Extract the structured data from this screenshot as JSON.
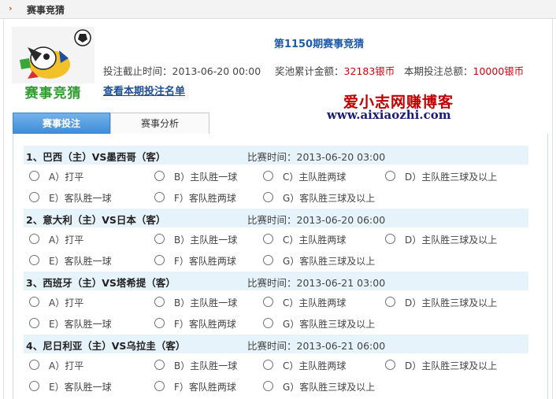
{
  "header": {
    "title": "赛事竞猜"
  },
  "logo": {
    "label": "赛事竞猜"
  },
  "issue": {
    "title": "第1150期赛事竞猜",
    "deadline_label": "投注截止时间：",
    "deadline": "2013-06-20 00:00",
    "pool_label": "奖池累计金额：",
    "pool": "32183银币",
    "total_label": "本期投注总额：",
    "total": "10000银币",
    "list_link": "查看本期投注名单"
  },
  "watermark": {
    "line1": "爱小志网赚博客",
    "line2": "www.aixiaozhi.com"
  },
  "tabs": [
    {
      "label": "赛事投注"
    },
    {
      "label": "赛事分析"
    }
  ],
  "options": [
    "A）打平",
    "B）主队胜一球",
    "C）主队胜两球",
    "D）主队胜三球及以上",
    "E）客队胜一球",
    "F）客队胜两球",
    "G）客队胜三球及以上"
  ],
  "matches": [
    {
      "name": "1、巴西（主）VS墨西哥（客）",
      "time": "比赛时间：2013-06-20 03:00"
    },
    {
      "name": "2、意大利（主）VS日本（客）",
      "time": "比赛时间：2013-06-20 06:00"
    },
    {
      "name": "3、西班牙（主）VS塔希提（客）",
      "time": "比赛时间：2013-06-21 03:00"
    },
    {
      "name": "4、尼日利亚（主）VS乌拉圭（客）",
      "time": "比赛时间：2013-06-21 06:00"
    }
  ]
}
